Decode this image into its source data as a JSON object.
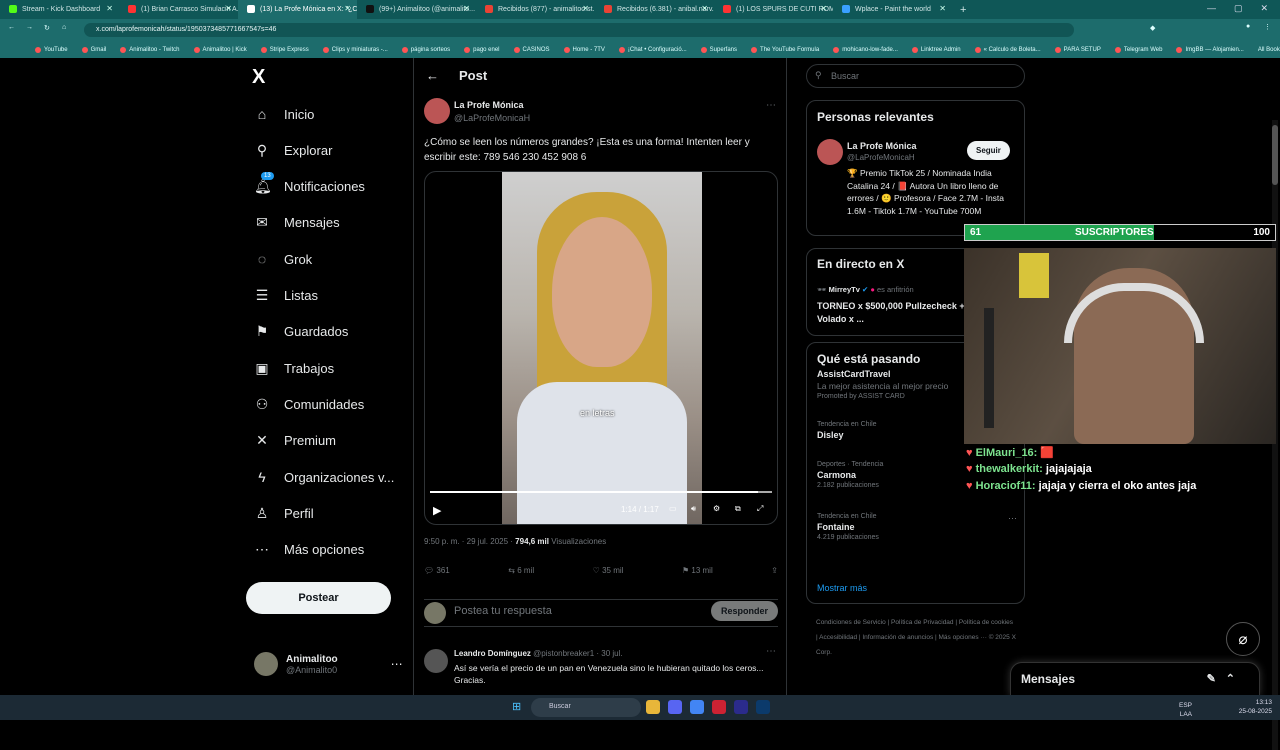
{
  "browser": {
    "tabs": [
      {
        "title": "Stream - Kick Dashboard",
        "color": "#53fc18"
      },
      {
        "title": "(1) Brian Carrasco Simulacin A...",
        "color": "#ff3333"
      },
      {
        "title": "(13) La Profe Mónica en X: \"¿Có...",
        "color": "#ffffff"
      },
      {
        "title": "(99+) Animalitoo (@animalito...",
        "color": "#111111"
      },
      {
        "title": "Recibidos (877) - animalitoo.st...",
        "color": "#ea4335"
      },
      {
        "title": "Recibidos (6.381) - anibal.narv...",
        "color": "#ea4335"
      },
      {
        "title": "(1) LOS SPURS DE CUTI ROMER...",
        "color": "#ff3333"
      },
      {
        "title": "Wplace - Paint the world",
        "color": "#3aa0ff"
      }
    ],
    "url": "x.com/laprofemonicah/status/1950373485771667547s=46",
    "bookmarks": [
      "YouTube",
      "Gmail",
      "Animalitoo - Twitch",
      "Animalitoo | Kick",
      "Stripe Express",
      "Clips y miniaturas -...",
      "página sorteos",
      "pago enel",
      "CASINOS",
      "Home - 7TV",
      "¡Chat • Configuració...",
      "Superfans",
      "The YouTube Formula",
      "mohicano-low-fade...",
      "Linktree Admin",
      "« Calculo de Boleta...",
      "PARA SETUP",
      "Telegram Web",
      "ImgBB — Alojamien..."
    ],
    "all_bookmarks": "All Bookmarks"
  },
  "nav": {
    "logo": "X",
    "items": [
      {
        "label": "Inicio",
        "icon": "home-icon",
        "glyph": "⌂"
      },
      {
        "label": "Explorar",
        "icon": "search-icon",
        "glyph": "⚲"
      },
      {
        "label": "Notificaciones",
        "icon": "bell-icon",
        "glyph": "🔔︎"
      },
      {
        "label": "Mensajes",
        "icon": "mail-icon",
        "glyph": "✉"
      },
      {
        "label": "Grok",
        "icon": "grok-icon",
        "glyph": "◌"
      },
      {
        "label": "Listas",
        "icon": "list-icon",
        "glyph": "☰"
      },
      {
        "label": "Guardados",
        "icon": "bookmark-icon",
        "glyph": "⚑"
      },
      {
        "label": "Trabajos",
        "icon": "briefcase-icon",
        "glyph": "▣"
      },
      {
        "label": "Comunidades",
        "icon": "people-icon",
        "glyph": "⚇"
      },
      {
        "label": "Premium",
        "icon": "x-icon",
        "glyph": "✕"
      },
      {
        "label": "Organizaciones v...",
        "icon": "lightning-icon",
        "glyph": "ϟ"
      },
      {
        "label": "Perfil",
        "icon": "person-icon",
        "glyph": "♙"
      },
      {
        "label": "Más opciones",
        "icon": "more-icon",
        "glyph": "⋯"
      }
    ],
    "notif_badge": "13",
    "post_button": "Postear",
    "user": {
      "name": "Animalitoo",
      "handle": "@Animalito0"
    }
  },
  "post": {
    "header": "Post",
    "author": {
      "name": "La Profe Mónica",
      "handle": "@LaProfeMonicaH"
    },
    "text": "¿Cómo se leen los números grandes? ¡Esta es una forma! Intenten leer y escribir este: 789 546 230 452 908 6",
    "video": {
      "caption": "en letras",
      "time": "1:14 / 1:17",
      "progress": 0.96
    },
    "meta_time": "9:50 p. m. · 29 jul. 2025 · ",
    "views": "794,6 mil",
    "views_label": "Visualizaciones",
    "stats": {
      "replies": "361",
      "reposts": "6 mil",
      "likes": "35 mil",
      "bookmarks": "13 mil"
    },
    "reply_placeholder": "Postea tu respuesta",
    "reply_button": "Responder"
  },
  "comment": {
    "name": "Leandro Domínguez",
    "handle": "@pistonbreaker1 · 30 jul.",
    "text": "Así se vería el precio de un pan en Venezuela sino le hubieran quitado los ceros... Gracias."
  },
  "sidebar": {
    "search_placeholder": "Buscar",
    "relevant": {
      "title": "Personas relevantes",
      "name": "La Profe Mónica",
      "handle": "@LaProfeMonicaH",
      "follow": "Seguir",
      "bio": "🏆 Premio TikTok 25 / Nominada India Catalina 24 / 📕 Autora Un libro lleno de errores / 🙂 Profesora / Face 2.7M - Insta 1.6M - Tiktok 1.7M - YouTube 700M"
    },
    "live": {
      "title": "En directo en X",
      "host": "MirreyTv",
      "host_suffix": " es anfitrión",
      "stream_title": "TORNEO x $500,000 Pullzecheck + Volado x ..."
    },
    "trending": {
      "title": "Qué está pasando",
      "items": [
        {
          "cat": "AssistCardTravel",
          "name": "La mejor asistencia al mejor precio",
          "cnt": "Promoted by ASSIST CARD"
        },
        {
          "cat": "Tendencia en Chile",
          "name": "Disley",
          "cnt": ""
        },
        {
          "cat": "Deportes · Tendencia",
          "name": "Carmona",
          "cnt": "2.182 publicaciones"
        },
        {
          "cat": "Tendencia en Chile",
          "name": "Fontaine",
          "cnt": "4.219 publicaciones"
        }
      ],
      "show_more": "Mostrar más"
    },
    "footer": "Condiciones de Servicio | Política de Privacidad | Política de cookies | Accesibilidad | Información de anuncios | Más opciones ··· © 2025 X Corp."
  },
  "stream_overlay": {
    "sub_current": "61",
    "sub_label": "SUSCRIPTORES",
    "sub_goal": "100",
    "chat": [
      {
        "user": "ElMauri_16:",
        "msg": " 🟥"
      },
      {
        "user": "thewalkerkit:",
        "msg": " jajajajaja"
      },
      {
        "user": "Horaciof11:",
        "msg": " jajaja y cierra el oko antes jaja"
      }
    ]
  },
  "messages_drawer": "Mensajes",
  "taskbar": {
    "search": "Buscar",
    "lang": "ESP LAA",
    "time": "13:13",
    "date": "25-08-2025"
  }
}
